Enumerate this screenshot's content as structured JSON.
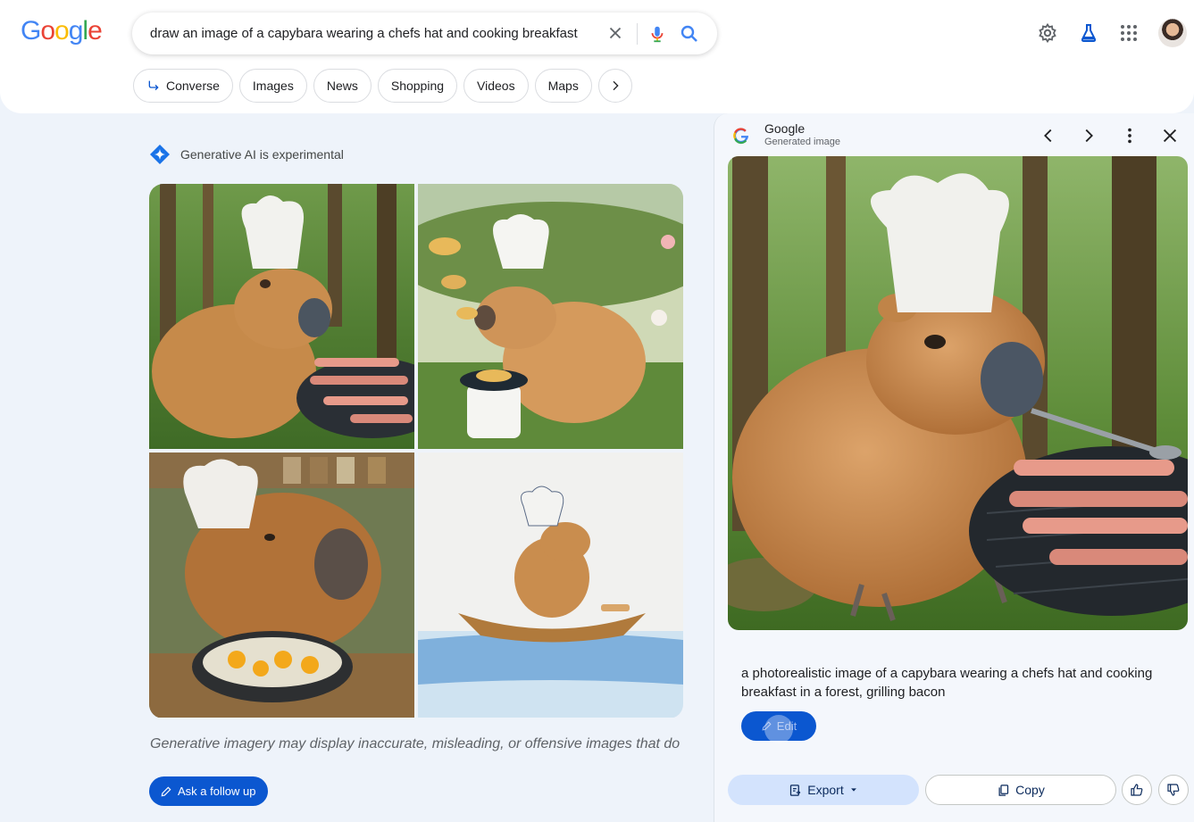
{
  "logo": [
    "G",
    "o",
    "o",
    "g",
    "l",
    "e"
  ],
  "search": {
    "query": "draw an image of a capybara wearing a chefs hat and cooking breakfast"
  },
  "chips": {
    "converse": "Converse",
    "images": "Images",
    "news": "News",
    "shopping": "Shopping",
    "videos": "Videos",
    "maps": "Maps"
  },
  "main": {
    "ai_label": "Generative AI is experimental",
    "disclaimer": "Generative imagery may display inaccurate, misleading, or offensive images that do",
    "followup_label": "Ask a follow up"
  },
  "panel": {
    "title": "Google",
    "subtitle": "Generated image",
    "caption": "a photorealistic image of a capybara wearing a chefs hat and cooking breakfast in a forest, grilling bacon",
    "edit_label": "Edit",
    "export_label": "Export",
    "copy_label": "Copy"
  },
  "colors": {
    "accent": "#0b57d0",
    "background": "#eef3fa",
    "panel": "#f4f7fc"
  },
  "icons": [
    "close-icon",
    "mic-icon",
    "search-icon",
    "gear-icon",
    "labs-flask-icon",
    "apps-grid-icon",
    "avatar",
    "converse-arrow-icon",
    "chevron-right-icon",
    "ai-sparkle-icon",
    "pencil-icon",
    "google-g-icon",
    "chevron-left-icon",
    "more-vert-icon",
    "export-icon",
    "copy-icon",
    "thumbs-up-icon",
    "thumbs-down-icon"
  ]
}
